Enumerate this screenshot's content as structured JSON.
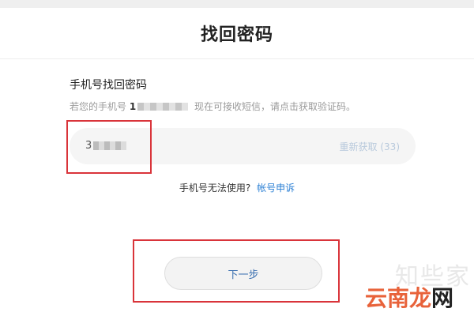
{
  "header": {
    "title": "找回密码"
  },
  "form": {
    "section_title": "手机号找回密码",
    "hint_prefix": "若您的手机号",
    "phone_visible": "1",
    "hint_suffix": "现在可接收短信，请点击获取验证码。",
    "code_input": {
      "value": "3"
    },
    "resend_label": "重新获取 (33)"
  },
  "help": {
    "question": "手机号无法使用?",
    "appeal_link": "帐号申诉"
  },
  "actions": {
    "next_label": "下一步"
  },
  "watermark": {
    "faint_text": "知些家",
    "logo_main": "云南龙",
    "logo_tail": "网"
  },
  "colors": {
    "highlight": "#d9343a",
    "link": "#2a7fd4",
    "resend": "#b8c9dc"
  }
}
